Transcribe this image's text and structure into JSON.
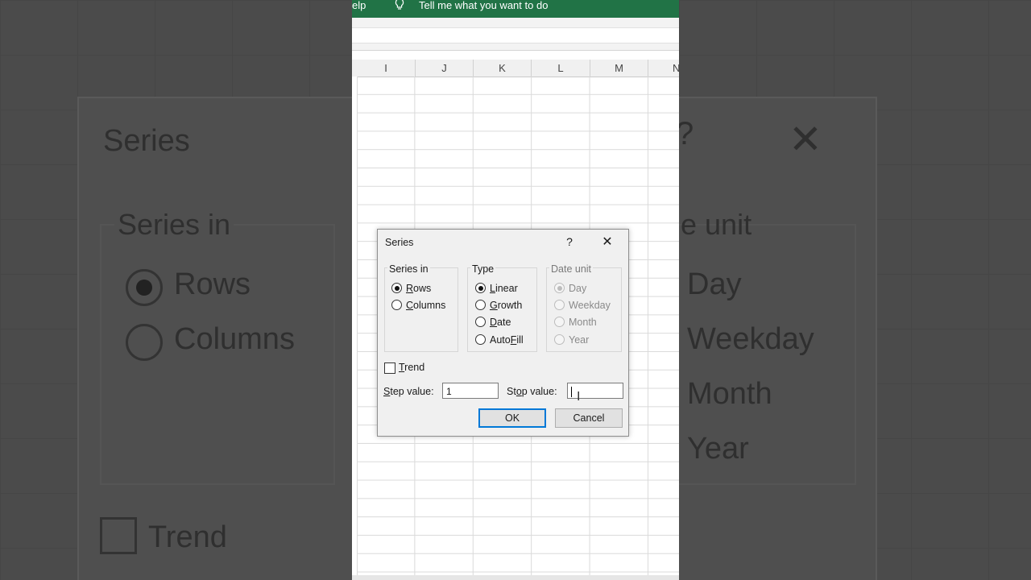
{
  "ribbon": {
    "help_label": "elp",
    "tell_me": "Tell me what you want to do"
  },
  "columns": [
    "I",
    "J",
    "K",
    "L",
    "M",
    "N"
  ],
  "dialog": {
    "title": "Series",
    "help_symbol": "?",
    "close_symbol": "✕",
    "series_in": {
      "label": "Series in",
      "options": [
        {
          "label": "Rows",
          "access": "R",
          "rest": "ows",
          "selected": true
        },
        {
          "label": "Columns",
          "access": "C",
          "rest": "olumns",
          "selected": false
        }
      ]
    },
    "type": {
      "label": "Type",
      "options": [
        {
          "label": "Linear",
          "access": "L",
          "rest": "inear",
          "selected": true
        },
        {
          "label": "Growth",
          "access": "G",
          "rest": "rowth",
          "selected": false
        },
        {
          "label": "Date",
          "access": "D",
          "rest": "ate",
          "selected": false
        },
        {
          "label": "AutoFill",
          "pre": "Auto",
          "access": "F",
          "rest": "ill",
          "selected": false
        }
      ]
    },
    "date_unit": {
      "label": "Date unit",
      "options": [
        {
          "label": "Day",
          "selected": true,
          "disabled": true
        },
        {
          "label": "Weekday",
          "selected": false,
          "disabled": true
        },
        {
          "label": "Month",
          "selected": false,
          "disabled": true
        },
        {
          "label": "Year",
          "selected": false,
          "disabled": true
        }
      ]
    },
    "trend": {
      "label": "Trend",
      "access": "T",
      "rest": "rend",
      "checked": false
    },
    "step_value": {
      "label_access": "S",
      "label_rest": "tep value:",
      "value": "1"
    },
    "stop_value": {
      "label_pre": "St",
      "label_access": "o",
      "label_rest": "p value:",
      "value": ""
    },
    "ok_label": "OK",
    "cancel_label": "Cancel"
  },
  "background": {
    "title": "Series",
    "series_in": "Series in",
    "rows": "Rows",
    "columns": "Columns",
    "trend": "Trend",
    "date_unit": "e unit",
    "day": "Day",
    "weekday": "Weekday",
    "month": "Month",
    "year": "Year"
  }
}
